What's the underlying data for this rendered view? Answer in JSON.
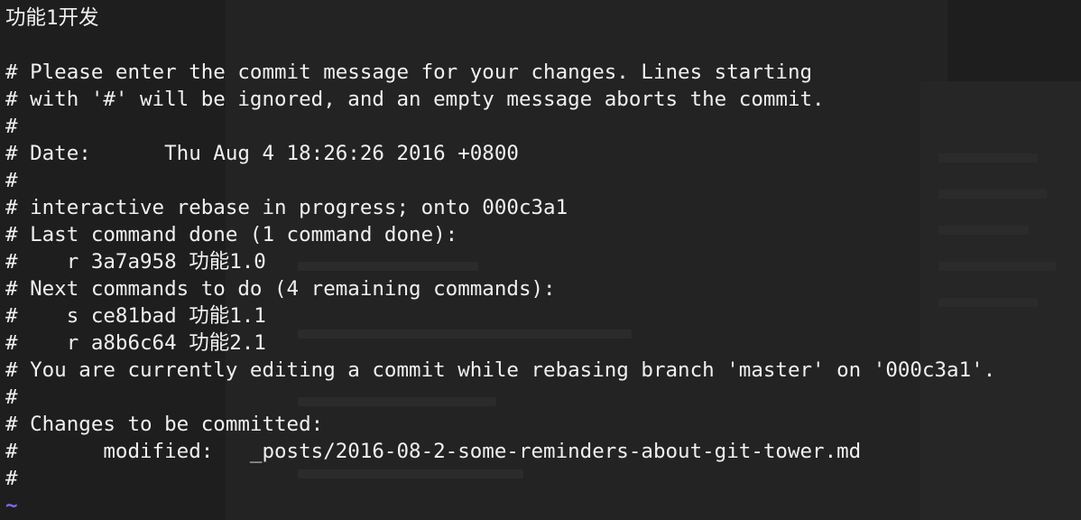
{
  "editor": {
    "lines": [
      "功能1开发",
      "",
      "# Please enter the commit message for your changes. Lines starting",
      "# with '#' will be ignored, and an empty message aborts the commit.",
      "#",
      "# Date:      Thu Aug 4 18:26:26 2016 +0800",
      "#",
      "# interactive rebase in progress; onto 000c3a1",
      "# Last command done (1 command done):",
      "#    r 3a7a958 功能1.0",
      "# Next commands to do (4 remaining commands):",
      "#    s ce81bad 功能1.1",
      "#    r a8b6c64 功能2.1",
      "# You are currently editing a commit while rebasing branch 'master' on '000c3a1'.",
      "#",
      "# Changes to be committed:",
      "#       modified:   _posts/2016-08-2-some-reminders-about-git-tower.md",
      "#"
    ],
    "empty_line_marker": "~",
    "colors": {
      "background": "#1e1e1e",
      "text": "#f0f0f0",
      "tilde": "#7b6cf0"
    }
  }
}
